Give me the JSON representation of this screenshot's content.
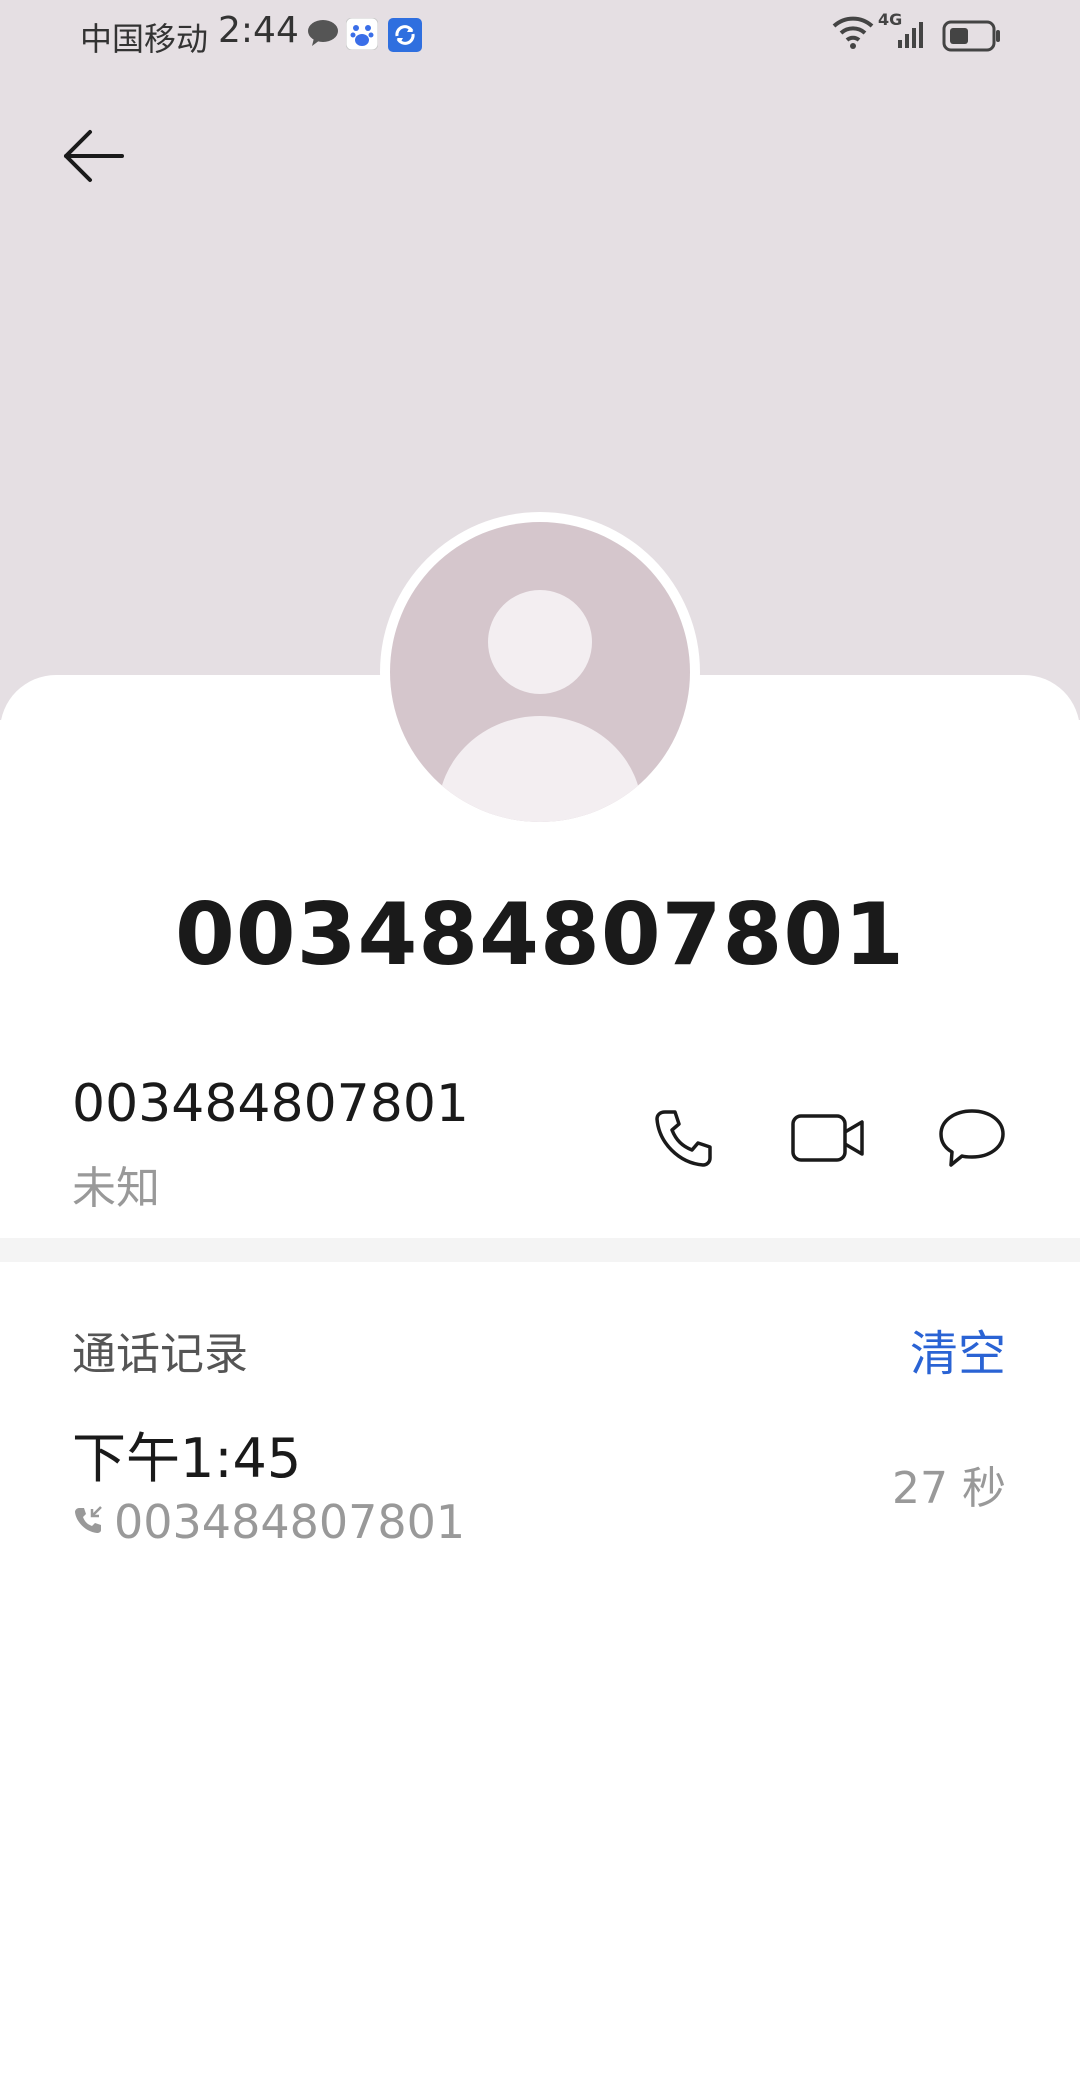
{
  "status_bar": {
    "carrier": "中国移动",
    "time": "2:44",
    "network": "4G",
    "notification_icons": [
      "message-bubble-icon",
      "baidu-icon",
      "sync-app-icon"
    ]
  },
  "contact": {
    "title": "003484807801",
    "number": "003484807801",
    "location": "未知"
  },
  "actions": [
    "phone-call-icon",
    "video-call-icon",
    "message-icon"
  ],
  "call_log": {
    "title": "通话记录",
    "clear_label": "清空",
    "entries": [
      {
        "time": "下午1:45",
        "number": "003484807801",
        "duration": "27 秒"
      }
    ]
  },
  "colors": {
    "header_bg": "#e5dfe3",
    "avatar_bg": "#d5c6cc",
    "accent": "#2a63d4"
  }
}
